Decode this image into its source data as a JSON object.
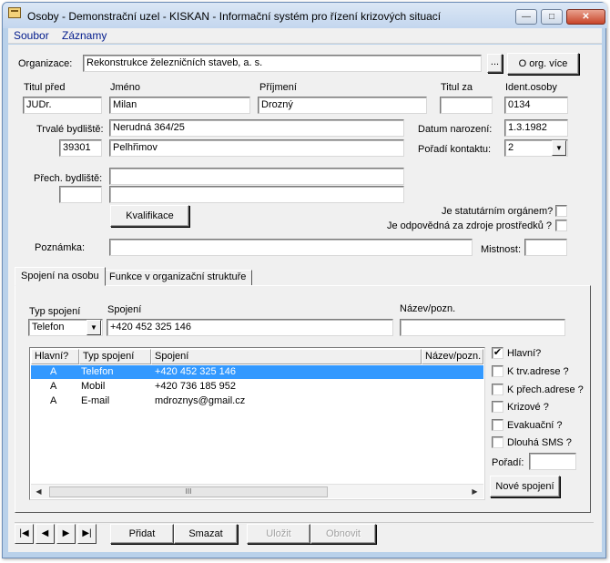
{
  "window": {
    "title": "Osoby - Demonstrační uzel - KISKAN - Informační systém pro řízení krizových situací",
    "minimize_glyph": "—",
    "maximize_glyph": "□",
    "close_glyph": "✕"
  },
  "menu": {
    "items": [
      {
        "label": "Soubor"
      },
      {
        "label": "Záznamy"
      }
    ]
  },
  "organization": {
    "label": "Organizace:",
    "value": "Rekonstrukce železničních staveb, a. s.",
    "browse_label": "...",
    "more_label": "O org. více"
  },
  "person": {
    "title_before_label": "Titul před",
    "title_before": "JUDr.",
    "first_name_label": "Jméno",
    "first_name": "Milan",
    "last_name_label": "Příjmení",
    "last_name": "Drozný",
    "title_after_label": "Titul za",
    "title_after": "",
    "ident_label": "Ident.osoby",
    "ident": "0134",
    "permanent_address_label": "Trvalé bydliště:",
    "street": "Nerudná 364/25",
    "zip": "39301",
    "city": "Pelhřimov",
    "temp_address_label": "Přech. bydliště:",
    "temp_street": "",
    "temp_zip": "",
    "temp_city": "",
    "birth_label": "Datum narození:",
    "birth_date": "1.3.1982",
    "contact_order_label": "Pořadí kontaktu:",
    "contact_order": "2",
    "qualification_label": "Kvalifikace",
    "statutory_label": "Je statutárním orgánem?",
    "resources_label": "Je odpovědná za zdroje prostředků ?",
    "note_label": "Poznámka:",
    "note": "",
    "room_label": "Mistnost:",
    "room": ""
  },
  "tabs": [
    {
      "label": "Spojení na osobu"
    },
    {
      "label": "Funkce v organizační struktuře"
    }
  ],
  "connection": {
    "type_label": "Typ spojení",
    "type_value": "Telefon",
    "value_label": "Spojení",
    "value": "+420 452 325 146",
    "note_label": "Název/pozn.",
    "note": ""
  },
  "list": {
    "columns": [
      "Hlavní?",
      "Typ spojení",
      "Spojení",
      "Název/pozn."
    ],
    "rows": [
      {
        "main": "A",
        "type": "Telefon",
        "value": "+420 452 325 146",
        "note": ""
      },
      {
        "main": "A",
        "type": "Mobil",
        "value": "+420 736 185 952",
        "note": ""
      },
      {
        "main": "A",
        "type": "E-mail",
        "value": "mdroznys@gmail.cz",
        "note": ""
      }
    ],
    "scroll_left": "◀",
    "scroll_right": "▶",
    "thumb_grip": "III"
  },
  "flags": {
    "main_label": "Hlavní?",
    "main_checked": "✔",
    "perm_addr_label": "K trv.adrese ?",
    "temp_addr_label": "K přech.adrese ?",
    "crisis_label": "Krizové ?",
    "evac_label": "Evakuační ?",
    "long_sms_label": "Dlouhá SMS ?",
    "order_label": "Pořadí:",
    "order": "",
    "new_connection_label": "Nové spojení"
  },
  "nav": {
    "first": "|◀",
    "prev": "◀",
    "next": "▶",
    "last": "▶|",
    "add_label": "Přidat",
    "delete_label": "Smazat",
    "save_label": "Uložit",
    "reload_label": "Obnovit"
  }
}
